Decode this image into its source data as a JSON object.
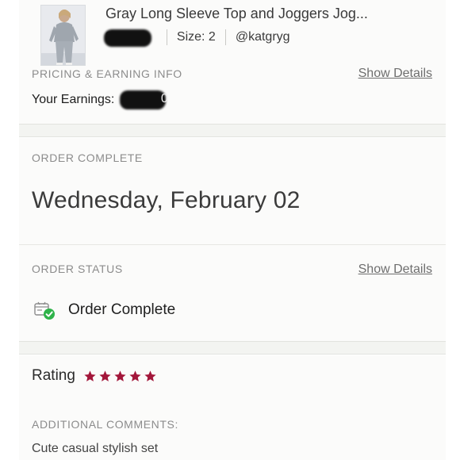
{
  "item": {
    "title": "Gray Long Sleeve Top and Joggers Jog...",
    "price": "$",
    "size": "Size: 2",
    "seller": "@katgryg"
  },
  "pricing": {
    "label": "PRICING & EARNING INFO",
    "show_details": "Show Details",
    "earnings_label": "Your Earnings:",
    "earnings_tail": "0"
  },
  "order_complete": {
    "label": "ORDER COMPLETE",
    "date": "Wednesday, February 02"
  },
  "order_status": {
    "label": "ORDER STATUS",
    "show_details": "Show Details",
    "status": "Order Complete",
    "icon": "order-complete-icon",
    "check_color": "#2fb34a"
  },
  "rating": {
    "label": "Rating",
    "stars": 5,
    "star_color": "#a3163a"
  },
  "comments": {
    "label": "ADDITIONAL COMMENTS:",
    "text": "Cute casual stylish set"
  }
}
